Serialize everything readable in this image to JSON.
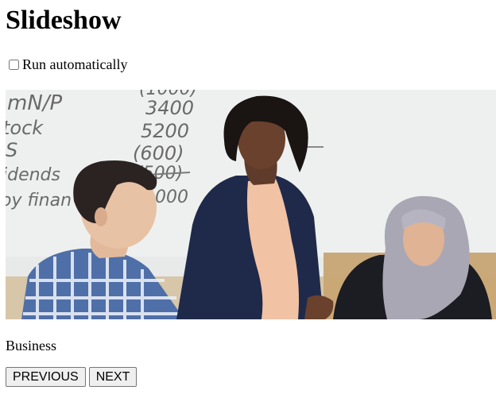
{
  "page": {
    "title": "Slideshow"
  },
  "autoplay": {
    "label": "Run automatically",
    "checked": false
  },
  "slide": {
    "caption": "Business",
    "whiteboard_lines": [
      "mN/P",
      "tock",
      "S",
      "idends",
      "oy finan"
    ],
    "whiteboard_numbers": [
      "(1000)",
      "3400",
      "5200",
      "(600)",
      "(500)",
      "000"
    ]
  },
  "controls": {
    "previous_label": "PREVIOUS",
    "next_label": "NEXT"
  }
}
